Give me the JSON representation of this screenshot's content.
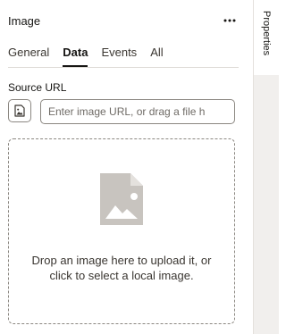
{
  "panel": {
    "title": "Image",
    "more_icon": "more-horizontal-icon"
  },
  "tabs": [
    {
      "label": "General",
      "active": false
    },
    {
      "label": "Data",
      "active": true
    },
    {
      "label": "Events",
      "active": false
    },
    {
      "label": "All",
      "active": false
    }
  ],
  "source": {
    "label": "Source URL",
    "file_icon": "image-file-icon",
    "input_value": "",
    "input_placeholder": "Enter image URL, or drag a file h"
  },
  "dropzone": {
    "icon": "image-placeholder-icon",
    "text": "Drop an image here to upload it, or click to select a local image."
  },
  "rail": {
    "tab_label": "Properties"
  },
  "colors": {
    "text": "#161513",
    "muted_text": "#3a3631",
    "border": "#8b8781",
    "icon_gray": "#c8c4bf",
    "rail_bg": "#f1efed"
  }
}
